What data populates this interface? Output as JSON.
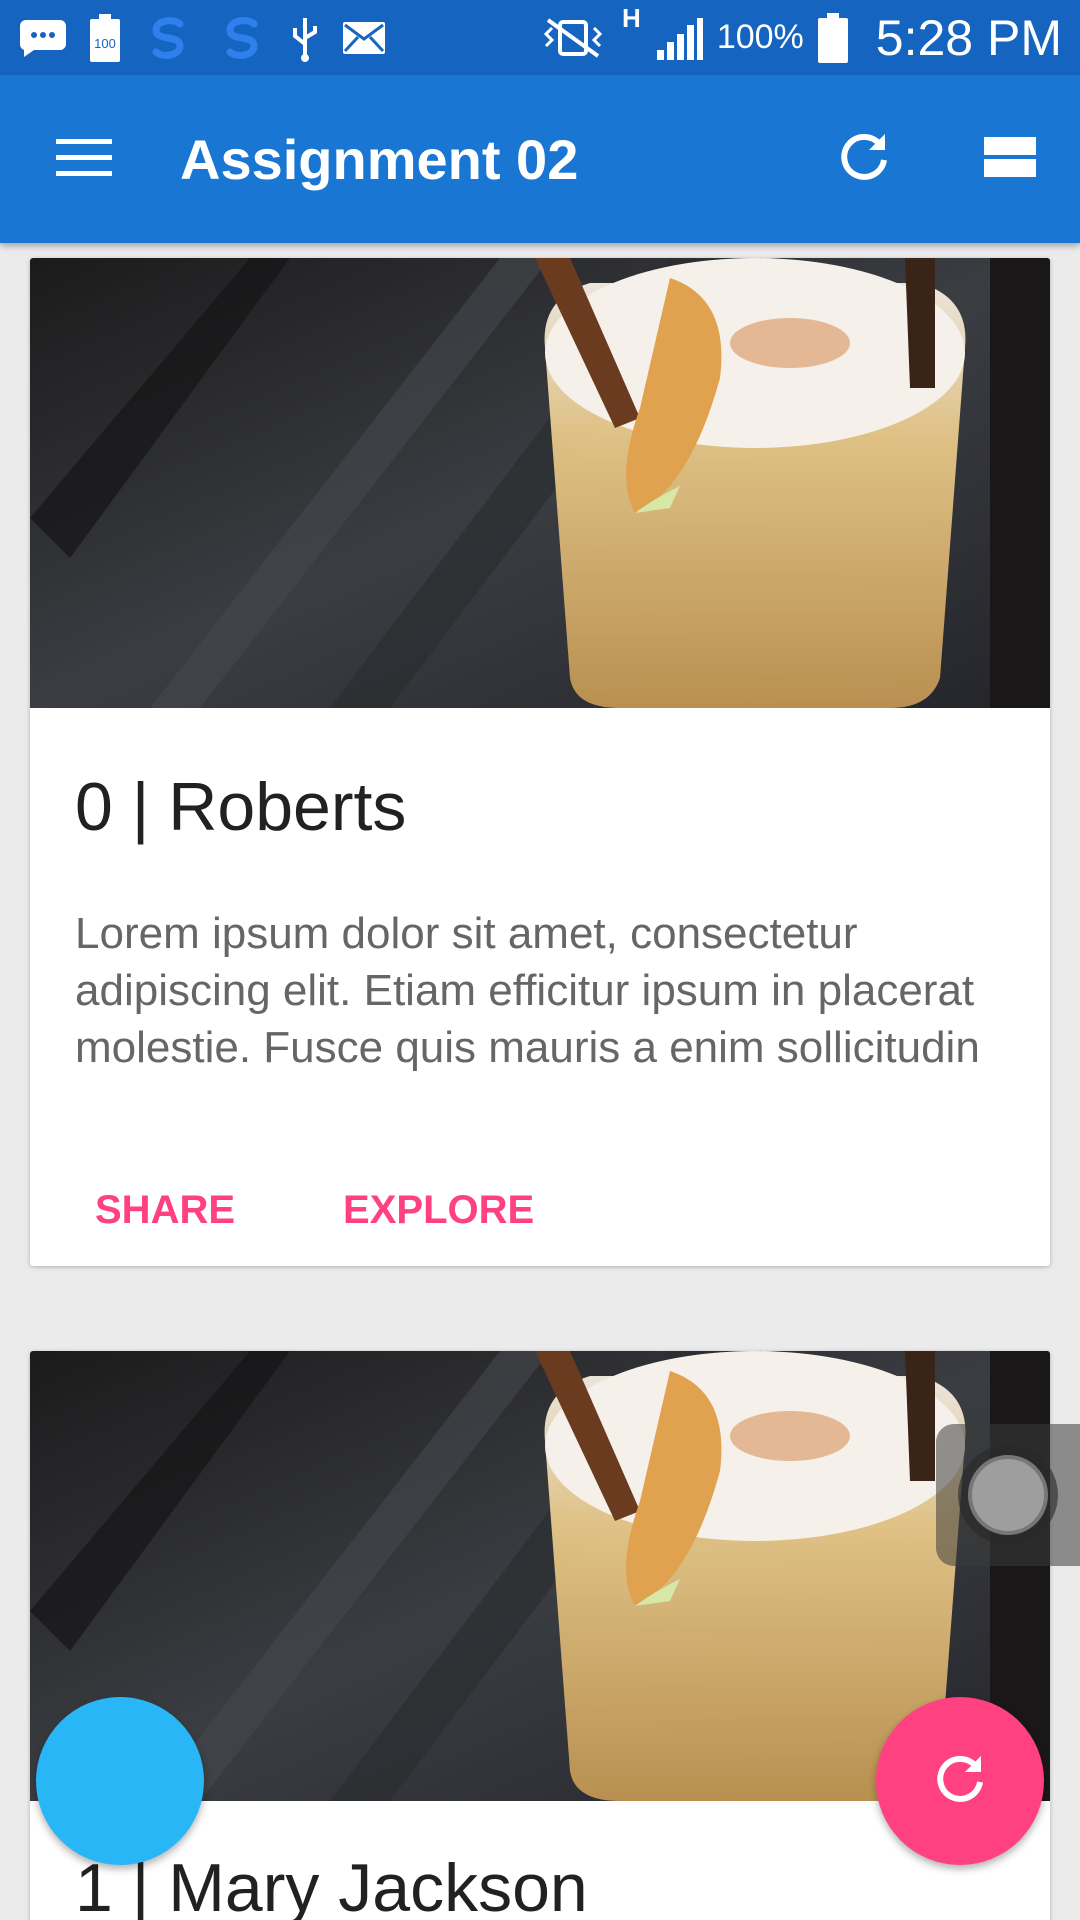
{
  "status_bar": {
    "battery_percent": "100%",
    "time": "5:28 PM",
    "network": "H",
    "notification_icons": [
      "chat-bubble-icon",
      "battery-100-icon",
      "skype-icon",
      "skype-icon",
      "usb-icon",
      "mail-icon"
    ],
    "battery_badge": "100"
  },
  "app_bar": {
    "title": "Assignment 02",
    "color": "#1976d2"
  },
  "cards": [
    {
      "title": "0 | Roberts",
      "text": "Lorem ipsum dolor sit amet, consectetur adipiscing elit. Etiam efficitur ipsum in placerat molestie. Fusce quis mauris a enim sollicitudin",
      "share_label": "SHARE",
      "explore_label": "EXPLORE",
      "image": "cocktail-photo"
    },
    {
      "title": "1 | Mary Jackson",
      "image": "cocktail-photo"
    }
  ],
  "colors": {
    "accent": "#ff4081",
    "fab_left": "#29b6f6",
    "status_bar": "#1565c0"
  }
}
